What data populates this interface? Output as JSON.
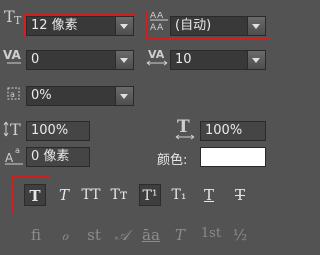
{
  "character_panel": {
    "font_size": {
      "value": "12 像素"
    },
    "leading": {
      "value": "(自动)"
    },
    "kerning": {
      "value": "0"
    },
    "tracking": {
      "value": "10"
    },
    "tsume": {
      "value": "0%"
    },
    "vertical_scale": {
      "value": "100%"
    },
    "horizontal_scale": {
      "value": "100%"
    },
    "baseline_shift": {
      "value": "0 像素"
    },
    "color": {
      "label": "颜色:",
      "swatch": "#ffffff"
    }
  },
  "style_buttons": [
    {
      "name": "faux-bold-button",
      "glyph": "T",
      "active": true
    },
    {
      "name": "faux-italic-button",
      "glyph": "T"
    },
    {
      "name": "all-caps-button",
      "glyph": "TT"
    },
    {
      "name": "small-caps-button",
      "glyph": "Tᴛ"
    },
    {
      "name": "superscript-button",
      "glyph": "T¹",
      "active": true
    },
    {
      "name": "subscript-button",
      "glyph": "T₁"
    },
    {
      "name": "underline-button",
      "glyph": "T"
    },
    {
      "name": "strikethrough-button",
      "glyph": "T"
    }
  ],
  "opentype_buttons": [
    {
      "name": "ligatures-button",
      "glyph": "fi"
    },
    {
      "name": "contextual-alternates-button",
      "glyph": "ℴ"
    },
    {
      "name": "discretionary-ligatures-button",
      "glyph": "st"
    },
    {
      "name": "swash-button",
      "glyph": "𝒜"
    },
    {
      "name": "stylistic-alternates-button",
      "glyph": "āa"
    },
    {
      "name": "titling-alternates-button",
      "glyph": "T"
    },
    {
      "name": "ordinals-button",
      "glyph": "1st"
    },
    {
      "name": "fractions-button",
      "glyph": "½"
    }
  ]
}
